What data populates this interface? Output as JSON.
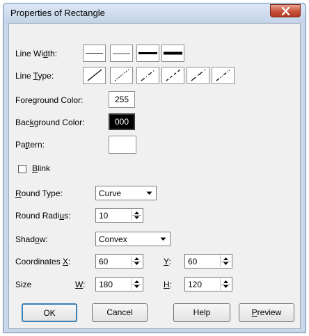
{
  "dialog": {
    "title": "Properties of Rectangle"
  },
  "labels": {
    "line_width_pre": "Line Wi",
    "line_width_key": "d",
    "line_width_post": "th:",
    "line_type_pre": "Line ",
    "line_type_key": "T",
    "line_type_post": "ype:",
    "fg_color": "Foreground Color:",
    "bg_color_pre": "Bac",
    "bg_color_key": "k",
    "bg_color_post": "ground Color:",
    "pattern_pre": "Pa",
    "pattern_key": "t",
    "pattern_post": "tern:",
    "blink_key": "B",
    "blink_post": "link",
    "round_type_key": "R",
    "round_type_post": "ound Type:",
    "round_radius_pre": "Round Radi",
    "round_radius_key": "u",
    "round_radius_post": "s:",
    "shadow_pre": "Shad",
    "shadow_key": "o",
    "shadow_post": "w:",
    "coordinates_pre": "Coordinates ",
    "coordinates_key": "X",
    "coordinates_post": ":",
    "y_key": "Y",
    "y_post": ":",
    "size": "Size",
    "w_key": "W",
    "w_post": ":",
    "h_key": "H",
    "h_post": ":"
  },
  "line_width_options": [
    "thin-1",
    "thin-2",
    "thick-1",
    "thick-2"
  ],
  "line_type_options": [
    "solid",
    "dotted",
    "dash-dot",
    "dashed",
    "long-dash",
    "dash-dot-dot"
  ],
  "fields": {
    "foreground_color": "255",
    "background_color": "000",
    "pattern": "",
    "blink_checked": false,
    "round_type": "Curve",
    "round_radius": "10",
    "shadow": "Convex",
    "coord_x": "60",
    "coord_y": "60",
    "width": "180",
    "height": "120"
  },
  "buttons": {
    "ok": "OK",
    "cancel": "Cancel",
    "help": "Help",
    "preview_key": "P",
    "preview_post": "review"
  },
  "colors": {
    "window_frame": "#c8d7ea",
    "client_bg": "#f0f0f0",
    "close_red": "#c7533a"
  },
  "icons": {
    "close": "close-icon",
    "dropdown": "chevron-down-icon",
    "spinner": "spin-updown-icon"
  }
}
